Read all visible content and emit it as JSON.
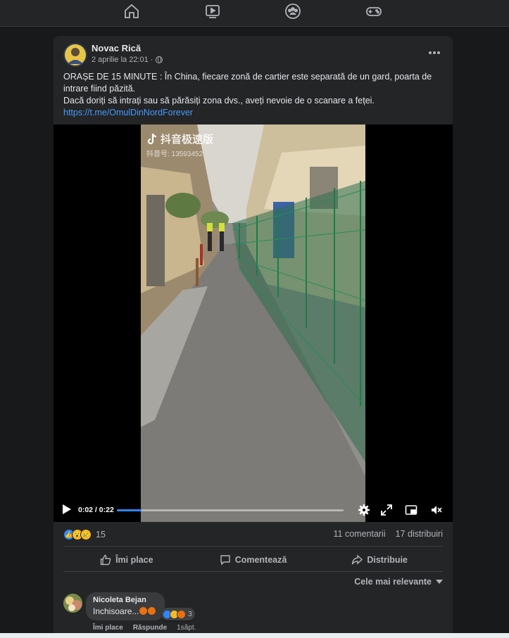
{
  "nav": {
    "icons": [
      "home-icon",
      "watch-icon",
      "groups-icon",
      "gaming-icon"
    ]
  },
  "post": {
    "author": "Novac Rică",
    "timestamp": "2 aprilie la 22:01 ·",
    "text_line1": "ORAȘE DE 15 MINUTE : În China, fiecare zonă de cartier este separată de un gard, poarta de intrare fiind păzită.",
    "text_line2": "Dacă doriți să intrați sau să părăsiți zona dvs., aveți nevoie de o scanare a feței.",
    "link": "https://t.me/OmulDinNordForever"
  },
  "video": {
    "watermark": "抖音极速版",
    "watermark_id": "抖音号: 13593452",
    "time": "0:02 / 0:22",
    "progress": 0.11
  },
  "stats": {
    "reaction_count": "15",
    "comments": "11 comentarii",
    "shares": "17 distribuiri"
  },
  "actions": {
    "like": "Îmi place",
    "comment": "Comentează",
    "share": "Distribuie"
  },
  "sort_label": "Cele mai relevante",
  "comment": {
    "author": "Nicoleta Bejan",
    "text": "Inchisoare...",
    "reaction_count": "3",
    "like": "Îmi place",
    "reply": "Răspunde",
    "age": "1săpt."
  },
  "colors": {
    "accent": "#2d88ff",
    "link": "#4599ff",
    "card_bg": "#242526",
    "page_bg": "#18191a"
  }
}
